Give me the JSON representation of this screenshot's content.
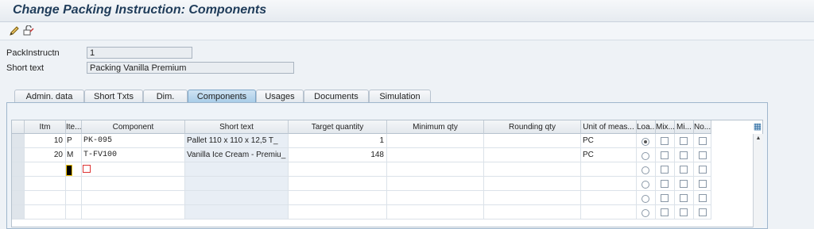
{
  "title": "Change Packing Instruction: Components",
  "toolbar": {
    "icons": [
      "edit-icon",
      "display-change-icon"
    ]
  },
  "header": {
    "pack_instr_label": "PackInstructn",
    "pack_instr_value": "1",
    "short_text_label": "Short text",
    "short_text_value": "Packing Vanilla Premium"
  },
  "tabs": [
    {
      "label": "Admin. data",
      "active": false
    },
    {
      "label": "Short Txts",
      "active": false
    },
    {
      "label": "Dim.",
      "active": false
    },
    {
      "label": "Components",
      "active": true
    },
    {
      "label": "Usages",
      "active": false
    },
    {
      "label": "Documents",
      "active": false
    },
    {
      "label": "Simulation",
      "active": false
    }
  ],
  "table": {
    "columns": [
      "Itm",
      "Ite...",
      "Component",
      "Short text",
      "Target quantity",
      "Minimum qty",
      "Rounding qty",
      "Unit of meas...",
      "Loa...",
      "Mix...",
      "Mi...",
      "No..."
    ],
    "rows": [
      {
        "itm": "10",
        "cat": "P",
        "component": "PK-095",
        "short_text": "Pallet 110 x 110 x 12,5 T_",
        "target": "1",
        "min": "",
        "round": "",
        "uom": "PC",
        "load": true
      },
      {
        "itm": "20",
        "cat": "M",
        "component": "T-FV100",
        "short_text": "Vanilla Ice Cream - Premiu_",
        "target": "148",
        "min": "",
        "round": "",
        "uom": "PC",
        "load": false
      }
    ]
  }
}
